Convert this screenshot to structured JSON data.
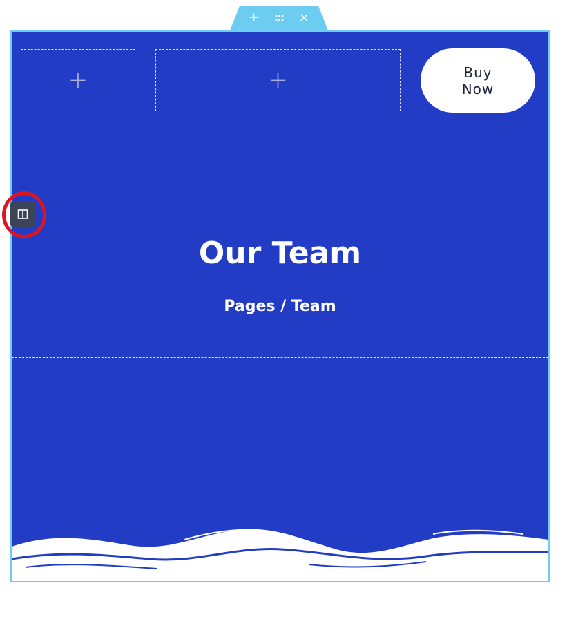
{
  "section_handle": {
    "add_glyph": "+",
    "move_glyph": ":::",
    "delete_glyph": "×"
  },
  "header": {
    "slot_add_glyph": "+",
    "buy_now_label": "Buy\nNow"
  },
  "hero": {
    "title": "Our Team",
    "breadcrumb": "Pages / Team"
  },
  "colors": {
    "section_background": "#223cc6",
    "editor_accent": "#6ccdf0",
    "highlight_ring": "#e0141c",
    "handle_dark": "#3e4458"
  },
  "icons": {
    "column_handle": "column-layout-icon"
  }
}
